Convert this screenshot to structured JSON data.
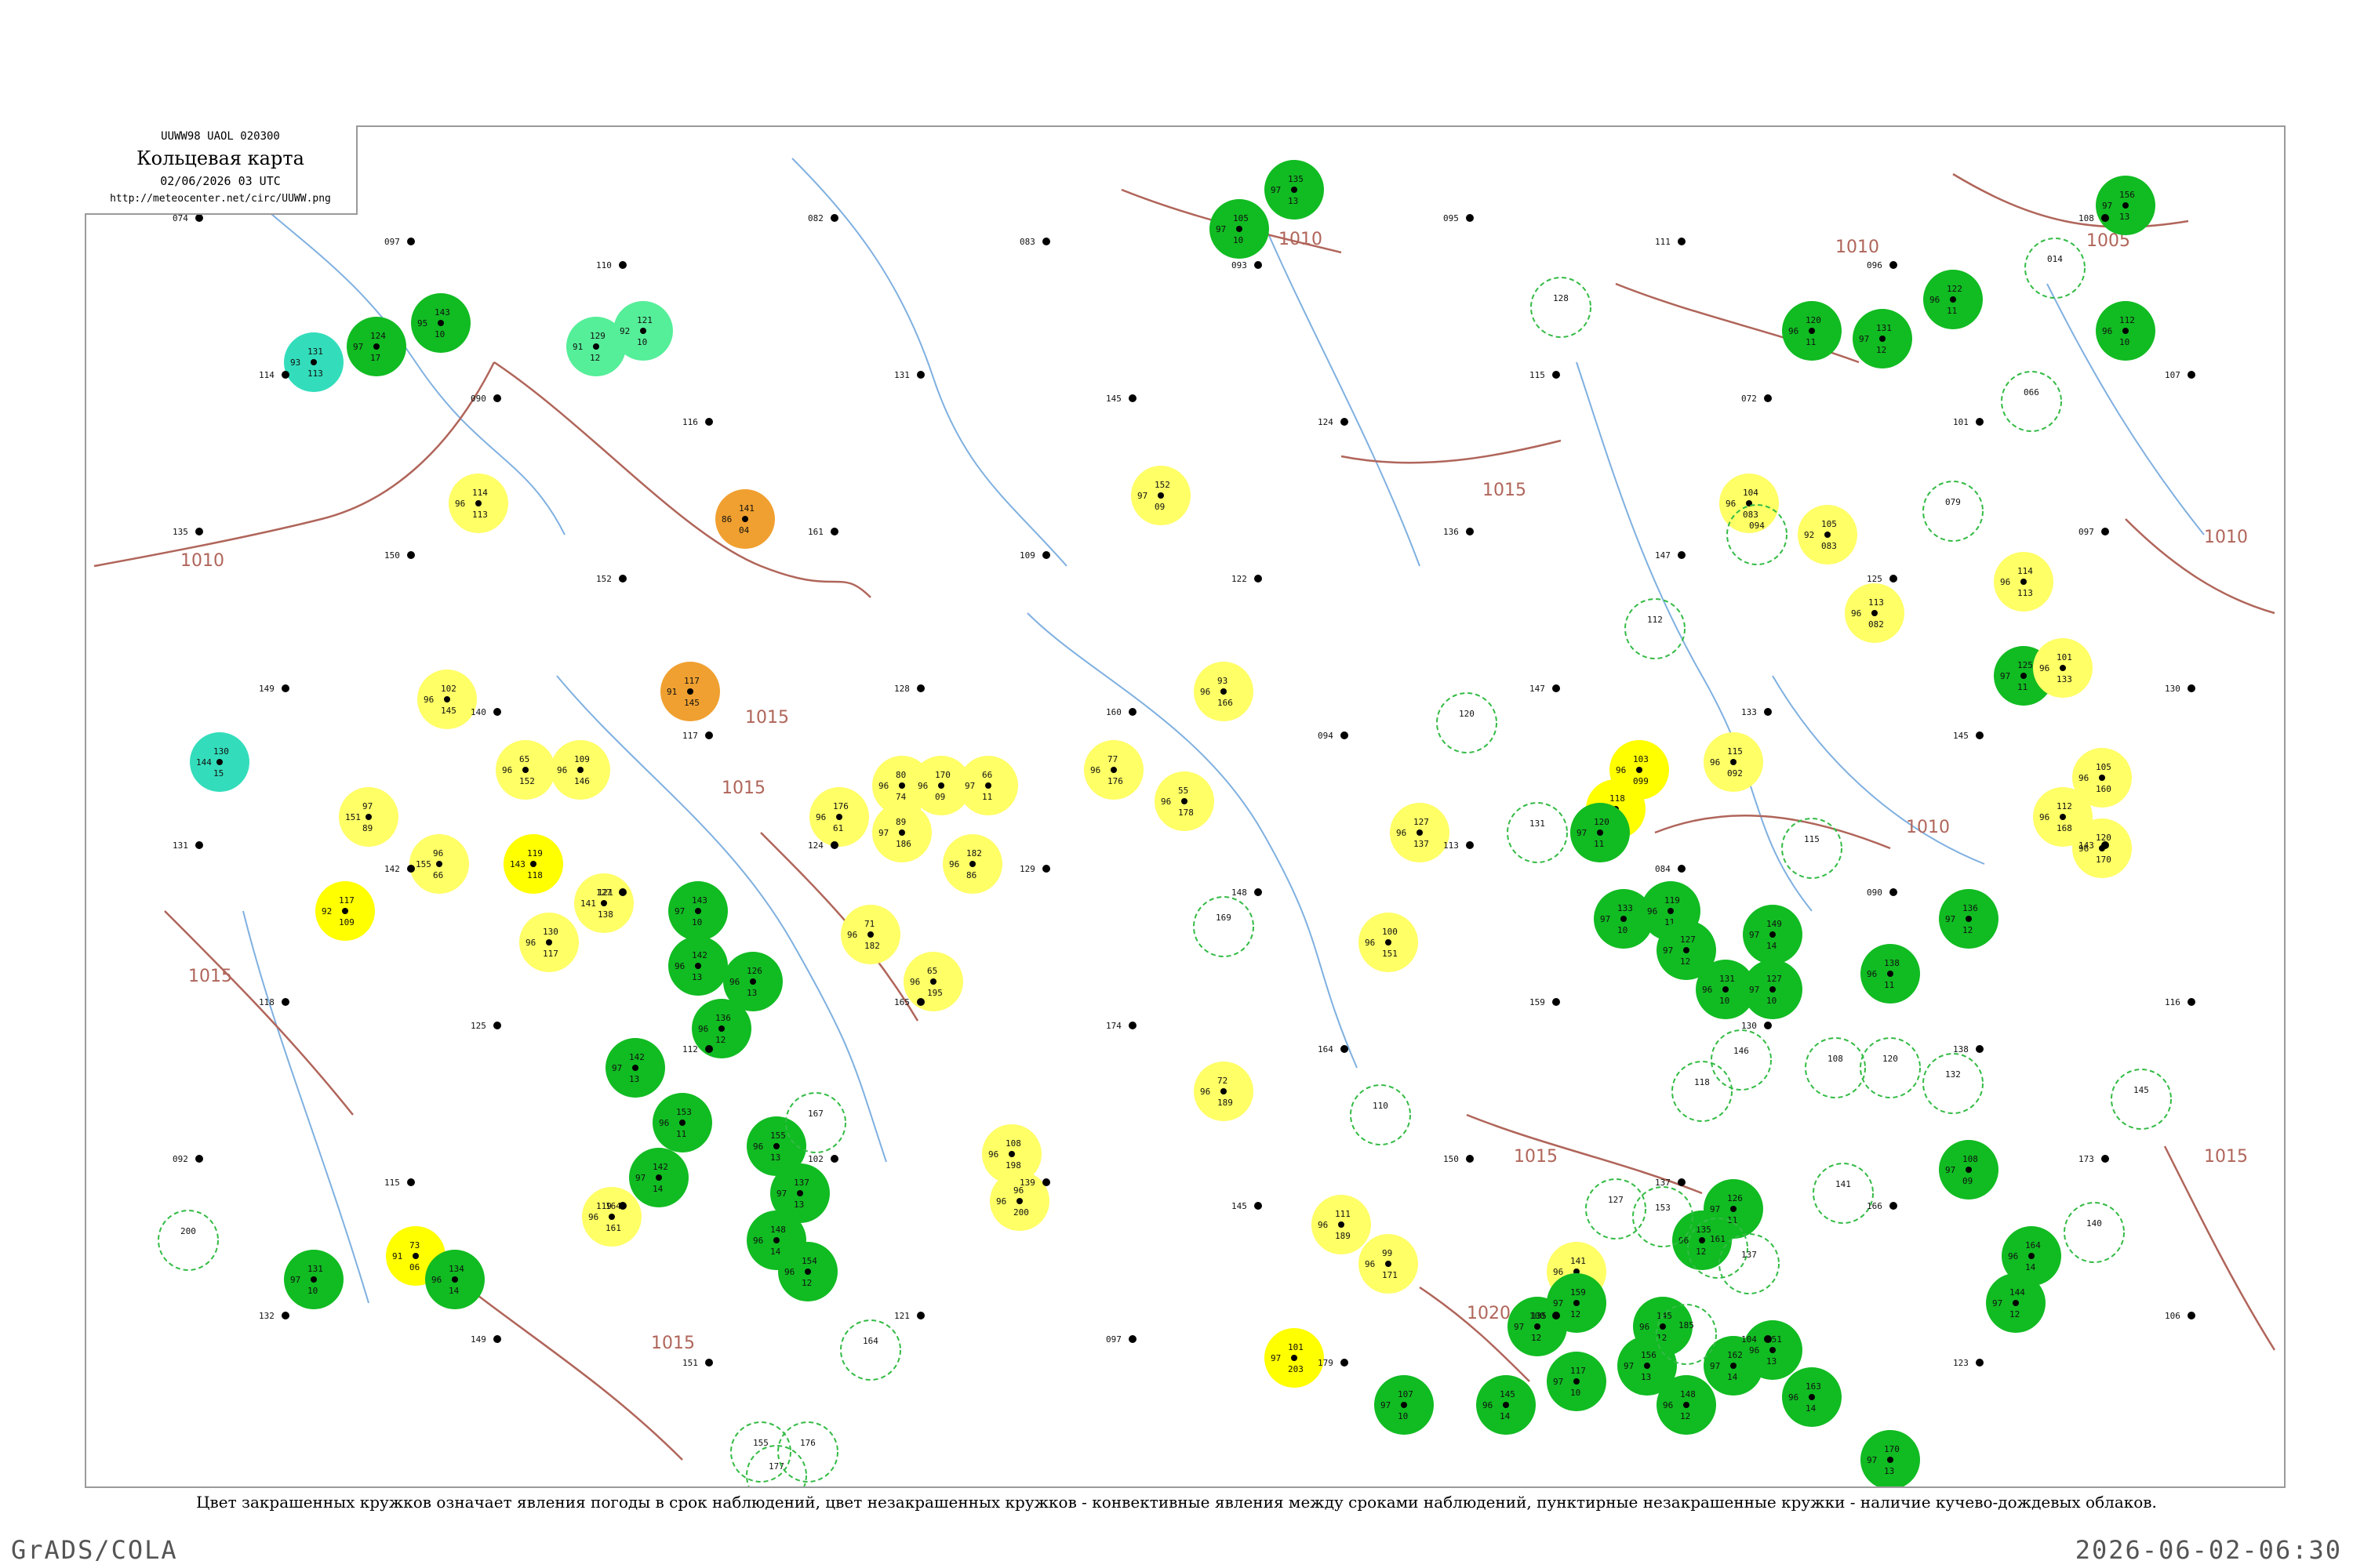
{
  "header": {
    "code": "UUWW98  UAOL  020300",
    "title": "Кольцевая карта",
    "time": "02/06/2026 03 UTC",
    "url": "http://meteocenter.net/circ/UUWW.png"
  },
  "legend_note": "Цвет закрашенных кружков означает явления погоды в срок наблюдений, цвет незакрашенных кружков - конвективные явления между сроками наблюдений, пунктирные незакрашенные кружки - наличие кучево-дождевых облаков.",
  "footer": {
    "left": "GrADS/COLA",
    "right": "2026-06-02-06:30"
  },
  "colors": {
    "isobar": "#b0655a",
    "rivers": "#7fb0e0",
    "rain": "#11bb22",
    "showers_light": "#ffff66",
    "showers": "#ffff00",
    "haze": "#f0a030",
    "cyan": "#33ddbb",
    "mint": "#55ee99",
    "cb_outline": "#33bb44"
  },
  "isobars": [
    {
      "label": "1010"
    },
    {
      "label": "1015"
    },
    {
      "label": "1010"
    },
    {
      "label": "1015"
    },
    {
      "label": "1010"
    },
    {
      "label": "1005"
    },
    {
      "label": "1010"
    },
    {
      "label": "1015"
    },
    {
      "label": "1015"
    },
    {
      "label": "1010"
    },
    {
      "label": "1015"
    },
    {
      "label": "1020"
    },
    {
      "label": "1015"
    },
    {
      "label": "1015"
    }
  ],
  "stations": [
    {
      "kind": "rain",
      "values": [
        "124",
        "97",
        "17"
      ]
    },
    {
      "kind": "rain",
      "values": [
        "143",
        "95",
        "10"
      ]
    },
    {
      "kind": "cyan",
      "values": [
        "131",
        "93",
        "113"
      ]
    },
    {
      "kind": "mint",
      "values": [
        "129",
        "91",
        "12"
      ]
    },
    {
      "kind": "mint",
      "values": [
        "121",
        "92",
        "10"
      ]
    },
    {
      "kind": "showers_light",
      "values": [
        "114",
        "96",
        "113"
      ]
    },
    {
      "kind": "haze",
      "values": [
        "141",
        "86",
        "04"
      ]
    },
    {
      "kind": "showers_light",
      "values": [
        "102",
        "96",
        "145"
      ]
    },
    {
      "kind": "haze",
      "values": [
        "117",
        "91",
        "145"
      ]
    },
    {
      "kind": "showers_light",
      "values": [
        "109",
        "96",
        "146"
      ]
    },
    {
      "kind": "showers_light",
      "values": [
        "65",
        "96",
        "152"
      ]
    },
    {
      "kind": "cyan",
      "values": [
        "130",
        "144",
        "15"
      ]
    },
    {
      "kind": "showers_light",
      "values": [
        "97",
        "151",
        "89"
      ]
    },
    {
      "kind": "showers_light",
      "values": [
        "96",
        "155",
        "66"
      ]
    },
    {
      "kind": "showers",
      "values": [
        "119",
        "143",
        "118"
      ]
    },
    {
      "kind": "showers",
      "values": [
        "117",
        "92",
        "109"
      ]
    },
    {
      "kind": "showers_light",
      "values": [
        "121",
        "141",
        "138"
      ]
    },
    {
      "kind": "showers_light",
      "values": [
        "130",
        "96",
        "117"
      ]
    },
    {
      "kind": "rain",
      "values": [
        "143",
        "97",
        "10"
      ]
    },
    {
      "kind": "rain",
      "values": [
        "142",
        "96",
        "13"
      ]
    },
    {
      "kind": "rain",
      "values": [
        "126",
        "96",
        "13"
      ]
    },
    {
      "kind": "rain",
      "values": [
        "136",
        "96",
        "12"
      ]
    },
    {
      "kind": "rain",
      "values": [
        "142",
        "97",
        "13"
      ]
    },
    {
      "kind": "rain",
      "values": [
        "153",
        "96",
        "11"
      ]
    },
    {
      "kind": "rain",
      "values": [
        "142",
        "97",
        "14"
      ]
    },
    {
      "kind": "showers_light",
      "values": [
        "164",
        "96",
        "161"
      ]
    },
    {
      "kind": "showers",
      "values": [
        "73",
        "91",
        "06"
      ]
    },
    {
      "kind": "rain",
      "values": [
        "131",
        "97",
        "10"
      ]
    },
    {
      "kind": "rain",
      "values": [
        "134",
        "96",
        "14"
      ]
    },
    {
      "kind": "rain",
      "values": [
        "155",
        "96",
        "13"
      ]
    },
    {
      "kind": "rain",
      "values": [
        "137",
        "97",
        "13"
      ]
    },
    {
      "kind": "rain",
      "values": [
        "148",
        "96",
        "14"
      ]
    },
    {
      "kind": "rain",
      "values": [
        "154",
        "96",
        "12"
      ]
    },
    {
      "kind": "showers_light",
      "values": [
        "80",
        "96",
        "74"
      ]
    },
    {
      "kind": "showers_light",
      "values": [
        "170",
        "96",
        "09"
      ]
    },
    {
      "kind": "showers_light",
      "values": [
        "66",
        "97",
        "11"
      ]
    },
    {
      "kind": "showers_light",
      "values": [
        "176",
        "96",
        "61"
      ]
    },
    {
      "kind": "showers_light",
      "values": [
        "89",
        "97",
        "186"
      ]
    },
    {
      "kind": "showers_light",
      "values": [
        "182",
        "96",
        "86"
      ]
    },
    {
      "kind": "showers_light",
      "values": [
        "71",
        "96",
        "182"
      ]
    },
    {
      "kind": "showers_light",
      "values": [
        "65",
        "96",
        "195"
      ]
    },
    {
      "kind": "showers_light",
      "values": [
        "152",
        "97",
        "09"
      ]
    },
    {
      "kind": "showers_light",
      "values": [
        "77",
        "96",
        "176"
      ]
    },
    {
      "kind": "showers_light",
      "values": [
        "55",
        "96",
        "178"
      ]
    },
    {
      "kind": "showers_light",
      "values": [
        "93",
        "96",
        "166"
      ]
    },
    {
      "kind": "showers_light",
      "values": [
        "108",
        "96",
        "198"
      ]
    },
    {
      "kind": "showers_light",
      "values": [
        "96",
        "96",
        "200"
      ]
    },
    {
      "kind": "showers_light",
      "values": [
        "72",
        "96",
        "189"
      ]
    },
    {
      "kind": "rain",
      "values": [
        "135",
        "97",
        "13"
      ]
    },
    {
      "kind": "rain",
      "values": [
        "105",
        "97",
        "10"
      ]
    },
    {
      "kind": "showers_light",
      "values": [
        "127",
        "96",
        "137"
      ]
    },
    {
      "kind": "showers_light",
      "values": [
        "100",
        "96",
        "151"
      ]
    },
    {
      "kind": "showers_light",
      "values": [
        "111",
        "96",
        "189"
      ]
    },
    {
      "kind": "showers_light",
      "values": [
        "99",
        "96",
        "171"
      ]
    },
    {
      "kind": "showers",
      "values": [
        "101",
        "97",
        "203"
      ]
    },
    {
      "kind": "rain",
      "values": [
        "107",
        "97",
        "10"
      ]
    },
    {
      "kind": "rain",
      "values": [
        "145",
        "96",
        "14"
      ]
    },
    {
      "kind": "rain",
      "values": [
        "135",
        "97",
        "12"
      ]
    },
    {
      "kind": "rain",
      "values": [
        "117",
        "97",
        "10"
      ]
    },
    {
      "kind": "showers_light",
      "values": [
        "104",
        "96",
        "083"
      ]
    },
    {
      "kind": "showers_light",
      "values": [
        "105",
        "92",
        "083"
      ]
    },
    {
      "kind": "showers_light",
      "values": [
        "113",
        "96",
        "082"
      ]
    },
    {
      "kind": "showers_light",
      "values": [
        "115",
        "96",
        "092"
      ]
    },
    {
      "kind": "showers",
      "values": [
        "118",
        "97",
        "107"
      ]
    },
    {
      "kind": "showers_light",
      "values": [
        "114",
        "96",
        "113"
      ]
    },
    {
      "kind": "showers",
      "values": [
        "103",
        "96",
        "099"
      ]
    },
    {
      "kind": "rain",
      "values": [
        "133",
        "97",
        "10"
      ]
    },
    {
      "kind": "rain",
      "values": [
        "120",
        "97",
        "11"
      ]
    },
    {
      "kind": "rain",
      "values": [
        "119",
        "96",
        "11"
      ]
    },
    {
      "kind": "rain",
      "values": [
        "127",
        "97",
        "12"
      ]
    },
    {
      "kind": "rain",
      "values": [
        "131",
        "96",
        "10"
      ]
    },
    {
      "kind": "rain",
      "values": [
        "149",
        "97",
        "14"
      ]
    },
    {
      "kind": "rain",
      "values": [
        "127",
        "97",
        "10"
      ]
    },
    {
      "kind": "rain",
      "values": [
        "138",
        "96",
        "11"
      ]
    },
    {
      "kind": "rain",
      "values": [
        "136",
        "97",
        "12"
      ]
    },
    {
      "kind": "rain",
      "values": [
        "108",
        "97",
        "09"
      ]
    },
    {
      "kind": "rain",
      "values": [
        "125",
        "97",
        "11"
      ]
    },
    {
      "kind": "showers_light",
      "values": [
        "101",
        "96",
        "133"
      ]
    },
    {
      "kind": "showers_light",
      "values": [
        "105",
        "96",
        "160"
      ]
    },
    {
      "kind": "showers_light",
      "values": [
        "112",
        "96",
        "168"
      ]
    },
    {
      "kind": "showers_light",
      "values": [
        "120",
        "96",
        "170"
      ]
    },
    {
      "kind": "showers_light",
      "values": [
        "141",
        "96",
        "148"
      ]
    },
    {
      "kind": "rain",
      "values": [
        "145",
        "96",
        "12"
      ]
    },
    {
      "kind": "rain",
      "values": [
        "156",
        "97",
        "13"
      ]
    },
    {
      "kind": "rain",
      "values": [
        "148",
        "96",
        "12"
      ]
    },
    {
      "kind": "rain",
      "values": [
        "162",
        "97",
        "14"
      ]
    },
    {
      "kind": "rain",
      "values": [
        "151",
        "96",
        "13"
      ]
    },
    {
      "kind": "rain",
      "values": [
        "159",
        "97",
        "12"
      ]
    },
    {
      "kind": "rain",
      "values": [
        "163",
        "96",
        "14"
      ]
    },
    {
      "kind": "rain",
      "values": [
        "170",
        "97",
        "13"
      ]
    },
    {
      "kind": "rain",
      "values": [
        "164",
        "96",
        "14"
      ]
    },
    {
      "kind": "rain",
      "values": [
        "144",
        "97",
        "12"
      ]
    },
    {
      "kind": "rain",
      "values": [
        "120",
        "96",
        "11"
      ]
    },
    {
      "kind": "rain",
      "values": [
        "131",
        "97",
        "12"
      ]
    },
    {
      "kind": "rain",
      "values": [
        "122",
        "96",
        "11"
      ]
    },
    {
      "kind": "rain",
      "values": [
        "156",
        "97",
        "13"
      ]
    },
    {
      "kind": "rain",
      "values": [
        "112",
        "96",
        "10"
      ]
    },
    {
      "kind": "rain",
      "values": [
        "126",
        "97",
        "11"
      ]
    },
    {
      "kind": "rain",
      "values": [
        "135",
        "96",
        "12"
      ]
    }
  ],
  "cb_rings": [
    {
      "value": "128"
    },
    {
      "value": "112"
    },
    {
      "value": "120"
    },
    {
      "value": "131"
    },
    {
      "value": "094"
    },
    {
      "value": "079"
    },
    {
      "value": "014"
    },
    {
      "value": "169"
    },
    {
      "value": "164"
    },
    {
      "value": "155"
    },
    {
      "value": "167"
    },
    {
      "value": "108"
    },
    {
      "value": "120"
    },
    {
      "value": "132"
    },
    {
      "value": "145"
    },
    {
      "value": "140"
    },
    {
      "value": "118"
    },
    {
      "value": "146"
    },
    {
      "value": "141"
    },
    {
      "value": "110"
    },
    {
      "value": "127"
    },
    {
      "value": "153"
    },
    {
      "value": "161"
    },
    {
      "value": "137"
    },
    {
      "value": "200"
    },
    {
      "value": "177"
    },
    {
      "value": "176"
    },
    {
      "value": "185"
    },
    {
      "value": "066"
    },
    {
      "value": "115"
    }
  ],
  "station_numbers": [
    "074",
    "097",
    "110",
    "082",
    "083",
    "093",
    "095",
    "111",
    "096",
    "108",
    "114",
    "090",
    "116",
    "131",
    "145",
    "124",
    "115",
    "072",
    "101",
    "107",
    "135",
    "150",
    "152",
    "161",
    "109",
    "122",
    "136",
    "147",
    "125",
    "097",
    "149",
    "140",
    "117",
    "128",
    "160",
    "094",
    "147",
    "133",
    "145",
    "130",
    "131",
    "142",
    "127",
    "124",
    "129",
    "148",
    "113",
    "084",
    "090",
    "143",
    "118",
    "125",
    "112",
    "165",
    "174",
    "164",
    "159",
    "130",
    "138",
    "116",
    "092",
    "115",
    "119",
    "102",
    "139",
    "145",
    "150",
    "137",
    "166",
    "173",
    "132",
    "149",
    "151",
    "121",
    "097",
    "179",
    "100",
    "104",
    "123",
    "106"
  ]
}
